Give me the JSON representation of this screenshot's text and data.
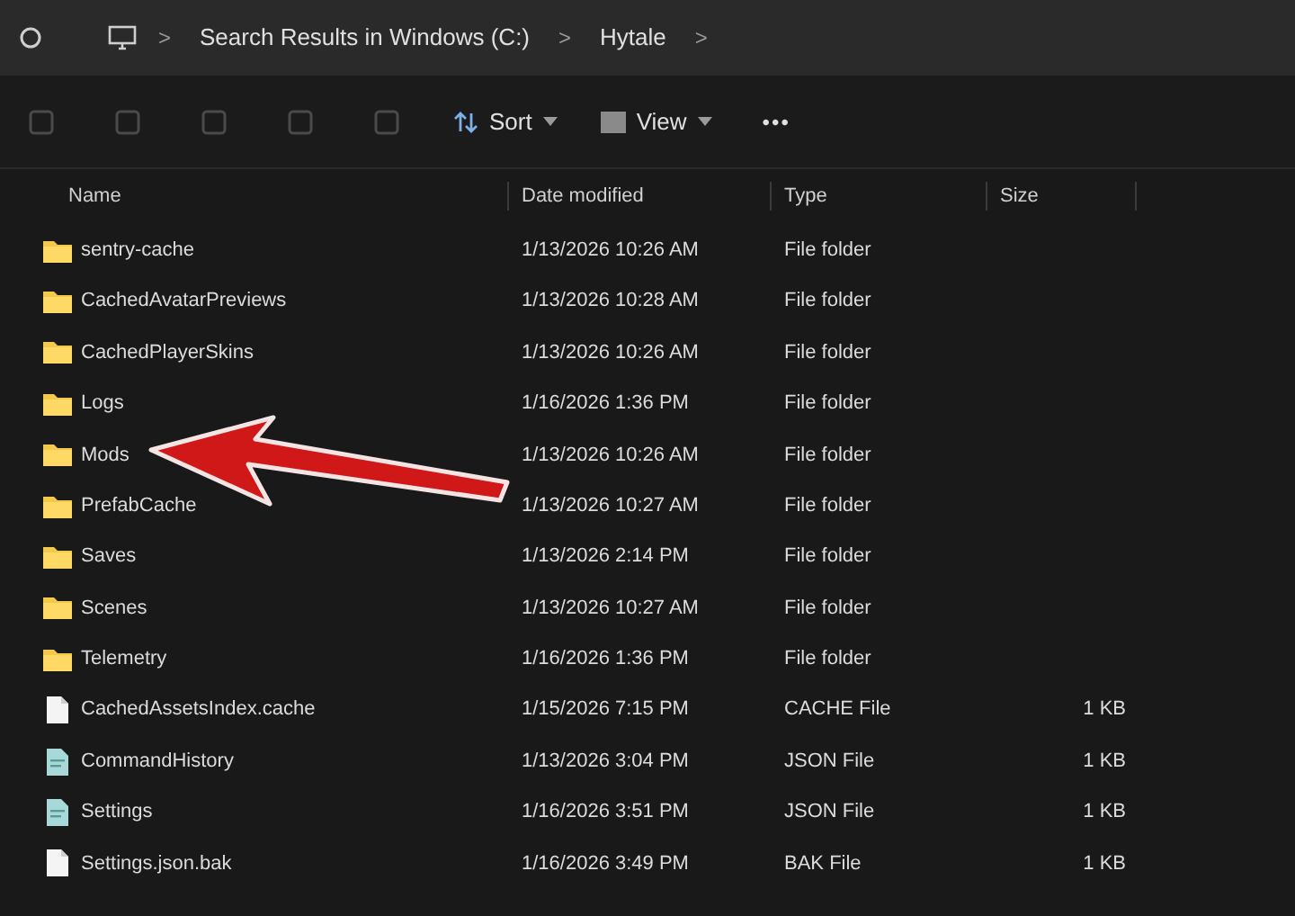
{
  "breadcrumb": [
    {
      "kind": "sep",
      "label": ">"
    },
    {
      "kind": "crumb",
      "label": "Search Results in Windows (C:)"
    },
    {
      "kind": "sep",
      "label": ">"
    },
    {
      "kind": "crumb",
      "label": "Hytale"
    },
    {
      "kind": "sep",
      "label": ">"
    }
  ],
  "toolbar": {
    "actions": [
      {
        "disabled": true
      },
      {
        "disabled": true
      },
      {
        "disabled": true
      },
      {
        "disabled": true
      },
      {
        "disabled": true
      }
    ],
    "sort": "Sort",
    "view": "View",
    "more": "•••"
  },
  "table": {
    "columns": [
      "Name",
      "Date modified",
      "Type",
      "Size"
    ],
    "rows": [
      {
        "kind": "folder",
        "name": "sentry-cache",
        "date": "1/13/2026 10:26 AM",
        "type": "File folder"
      },
      {
        "kind": "folder",
        "name": "CachedAvatarPreviews",
        "date": "1/13/2026 10:28 AM",
        "type": "File folder"
      },
      {
        "kind": "folder",
        "name": "CachedPlayerSkins",
        "date": "1/13/2026 10:26 AM",
        "type": "File folder"
      },
      {
        "kind": "folder",
        "name": "Logs",
        "date": "1/16/2026 1:36 PM",
        "type": "File folder"
      },
      {
        "kind": "folder",
        "name": "Mods",
        "date": "1/13/2026 10:26 AM",
        "type": "File folder"
      },
      {
        "kind": "folder",
        "name": "PrefabCache",
        "date": "1/13/2026 10:27 AM",
        "type": "File folder"
      },
      {
        "kind": "folder",
        "name": "Saves",
        "date": "1/13/2026 2:14 PM",
        "type": "File folder"
      },
      {
        "kind": "folder",
        "name": "Scenes",
        "date": "1/13/2026 10:27 AM",
        "type": "File folder"
      },
      {
        "kind": "folder",
        "name": "Telemetry",
        "date": "1/16/2026 1:36 PM",
        "type": "File folder"
      },
      {
        "kind": "file",
        "name": "CachedAssetsIndex.cache",
        "date": "1/15/2026 7:15 PM",
        "type": "CACHE File",
        "size": "1 KB"
      },
      {
        "kind": "json",
        "name": "CommandHistory",
        "date": "1/13/2026 3:04 PM",
        "type": "JSON File",
        "size": "1 KB"
      },
      {
        "kind": "json",
        "name": "Settings",
        "date": "1/16/2026 3:51 PM",
        "type": "JSON File",
        "size": "1 KB"
      },
      {
        "kind": "file",
        "name": "Settings.json.bak",
        "date": "1/16/2026 3:49 PM",
        "type": "BAK File",
        "size": "1 KB"
      }
    ]
  }
}
